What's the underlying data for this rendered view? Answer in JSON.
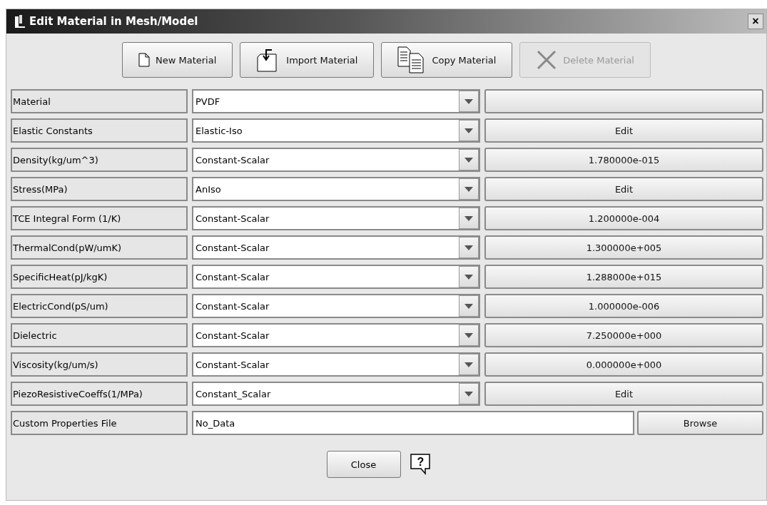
{
  "window": {
    "title": "Edit Material in Mesh/Model",
    "close": "×"
  },
  "toolbar": [
    {
      "kind": "new",
      "label": "New Material",
      "disabled": false
    },
    {
      "kind": "import",
      "label": "Import Material",
      "disabled": false
    },
    {
      "kind": "copy",
      "label": "Copy Material",
      "disabled": false
    },
    {
      "kind": "delete",
      "label": "Delete Material",
      "disabled": true
    }
  ],
  "rows": [
    {
      "kind": "combo",
      "label": "Material",
      "value": "PVDF"
    },
    {
      "kind": "combo",
      "label": "Elastic Constants",
      "value": "Elastic-Iso",
      "action": "Edit"
    },
    {
      "kind": "combo",
      "label": "Density(kg/um^3)",
      "value": "Constant-Scalar",
      "action": "1.780000e-015"
    },
    {
      "kind": "combo",
      "label": "Stress(MPa)",
      "value": "AnIso",
      "action": "Edit"
    },
    {
      "kind": "combo",
      "label": "TCE Integral Form (1/K)",
      "value": "Constant-Scalar",
      "action": "1.200000e-004"
    },
    {
      "kind": "combo",
      "label": "ThermalCond(pW/umK)",
      "value": "Constant-Scalar",
      "action": "1.300000e+005"
    },
    {
      "kind": "combo",
      "label": "SpecificHeat(pJ/kgK)",
      "value": "Constant-Scalar",
      "action": "1.288000e+015"
    },
    {
      "kind": "combo",
      "label": "ElectricCond(pS/um)",
      "value": "Constant-Scalar",
      "action": "1.000000e-006"
    },
    {
      "kind": "combo",
      "label": "Dielectric",
      "value": "Constant-Scalar",
      "action": "7.250000e+000"
    },
    {
      "kind": "combo",
      "label": "Viscosity(kg/um/s)",
      "value": "Constant-Scalar",
      "action": "0.000000e+000"
    },
    {
      "kind": "combo",
      "label": "PiezoResistiveCoeffs(1/MPa)",
      "value": "Constant_Scalar",
      "action": "Edit"
    },
    {
      "kind": "file",
      "label": "Custom Properties File",
      "value": "No_Data",
      "action": "Browse"
    }
  ],
  "footer": {
    "close": "Close",
    "help": "?"
  }
}
